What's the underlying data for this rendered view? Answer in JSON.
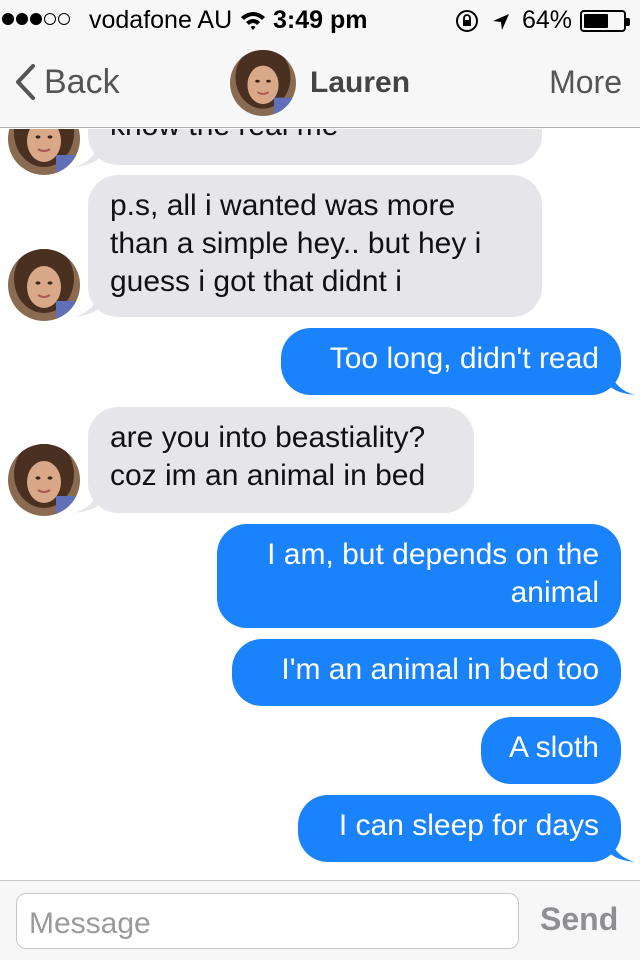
{
  "status_bar": {
    "signal_bars_filled": 3,
    "signal_bars_total": 5,
    "carrier": "vodafone AU",
    "time": "3:49 pm",
    "battery_percent": "64%",
    "battery_level": 0.64,
    "icons": [
      "wifi-icon",
      "rotation-lock-icon",
      "location-arrow-icon",
      "battery-icon"
    ]
  },
  "nav": {
    "back_label": "Back",
    "contact_name": "Lauren",
    "more_label": "More",
    "icons": [
      "chevron-left-icon",
      "contact-avatar"
    ]
  },
  "messages": [
    {
      "sender": "Lauren",
      "direction": "incoming",
      "lines": [
        "know the real me"
      ],
      "partially_visible": true
    },
    {
      "sender": "Lauren",
      "direction": "incoming",
      "lines": [
        "p.s, all i wanted was more",
        "than a simple hey.. but hey i",
        "guess i got that didnt i"
      ]
    },
    {
      "sender": "me",
      "direction": "outgoing",
      "lines": [
        "Too long, didn't read"
      ]
    },
    {
      "sender": "Lauren",
      "direction": "incoming",
      "lines": [
        "are you into beastiality?",
        "coz im an animal in bed"
      ]
    },
    {
      "sender": "me",
      "direction": "outgoing",
      "lines": [
        "I am, but depends on the",
        "animal"
      ]
    },
    {
      "sender": "me",
      "direction": "outgoing",
      "lines": [
        "I'm an animal in bed too"
      ]
    },
    {
      "sender": "me",
      "direction": "outgoing",
      "lines": [
        "A sloth"
      ]
    },
    {
      "sender": "me",
      "direction": "outgoing",
      "lines": [
        "I can sleep for days"
      ]
    }
  ],
  "compose": {
    "placeholder": "Message",
    "value": "",
    "send_label": "Send"
  },
  "colors": {
    "outgoing_bubble": "#1a82fb",
    "incoming_bubble": "#e5e5ea",
    "bar_background": "#f7f7f7",
    "send_disabled": "#8e8e93"
  }
}
